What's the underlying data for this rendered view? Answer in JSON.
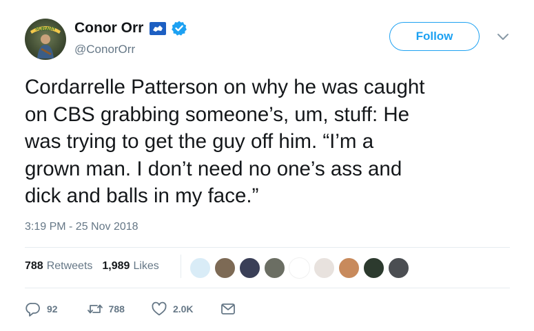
{
  "author": {
    "display_name": "Conor Orr",
    "handle": "@ConorOrr",
    "avatar_text": "SUBWAY",
    "follow_label": "Follow"
  },
  "tweet": {
    "text": "Cordarrelle Patterson on why he was caught\non CBS grabbing someone’s, um, stuff: He\nwas trying to get the guy off him. “I’m a\ngrown man. I don’t need no one’s ass and\ndick and balls in my face.”",
    "timestamp": "3:19 PM - 25 Nov 2018"
  },
  "stats": {
    "retweets_count": "788",
    "retweets_label": "Retweets",
    "likes_count": "1,989",
    "likes_label": "Likes"
  },
  "likers": [
    {
      "name": "liker-avatar-snowman",
      "color": "#d9ecf7"
    },
    {
      "name": "liker-avatar-2",
      "color": "#7d6a55"
    },
    {
      "name": "liker-avatar-3",
      "color": "#3a3f57"
    },
    {
      "name": "liker-avatar-4",
      "color": "#6b6e63"
    },
    {
      "name": "liker-avatar-rooster",
      "color": "#ffffff"
    },
    {
      "name": "liker-avatar-6",
      "color": "#e8e2de"
    },
    {
      "name": "liker-avatar-7",
      "color": "#c88a5c"
    },
    {
      "name": "liker-avatar-8",
      "color": "#2c3a2e"
    },
    {
      "name": "liker-avatar-9",
      "color": "#4b4e52"
    }
  ],
  "actions": {
    "reply_count": "92",
    "retweet_count": "788",
    "like_count": "2.0K"
  },
  "colors": {
    "accent": "#1da1f2",
    "secondary_text": "#657786",
    "divider": "#e6ecf0"
  }
}
